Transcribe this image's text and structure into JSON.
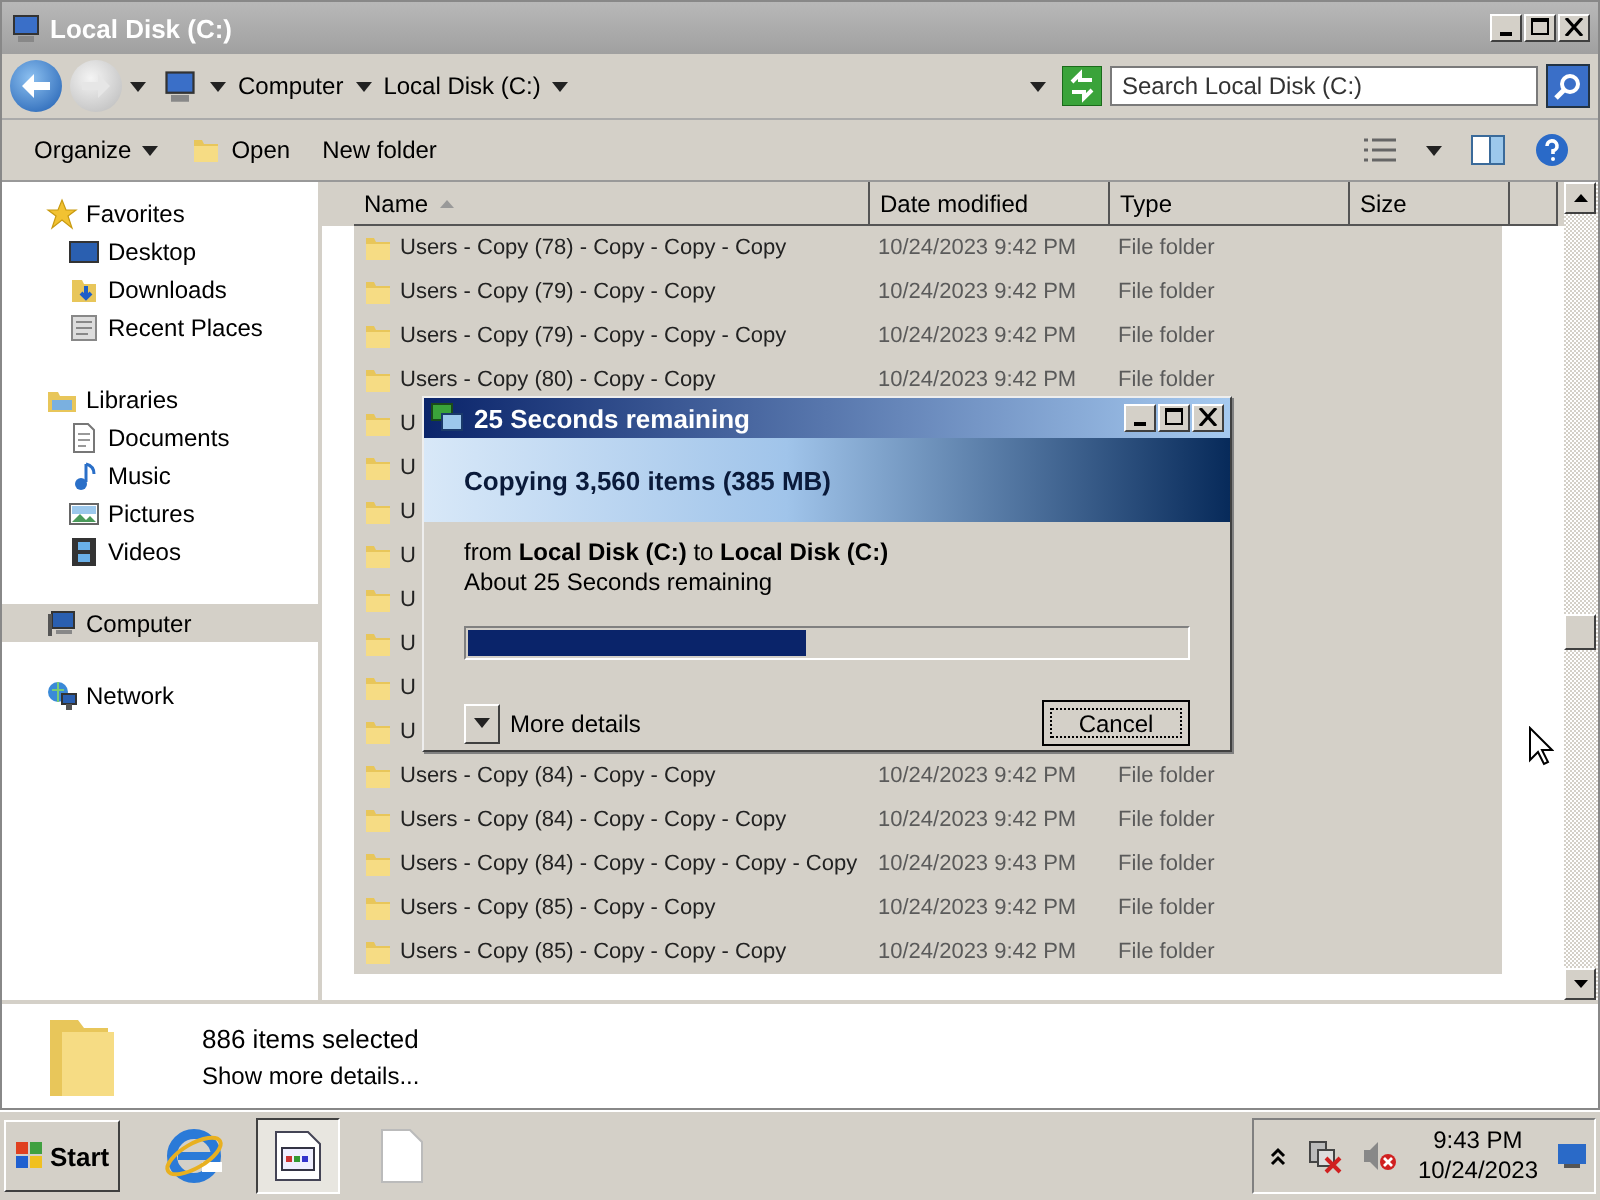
{
  "window": {
    "title": "Local Disk (C:)"
  },
  "address": {
    "breadcrumb": [
      "Computer",
      "Local Disk (C:)"
    ],
    "search": {
      "placeholder": "Search Local Disk (C:)"
    }
  },
  "toolbar": [
    {
      "label": "Organize",
      "kind": "menu"
    },
    {
      "label": "Open",
      "kind": "open"
    },
    {
      "label": "New folder",
      "kind": "plain"
    }
  ],
  "sidebar": {
    "groups": [
      {
        "label": "Favorites",
        "kind": "star",
        "selected": false,
        "children": [
          {
            "label": "Desktop",
            "kind": "desktop",
            "selected": false
          },
          {
            "label": "Downloads",
            "kind": "downloads",
            "selected": false
          },
          {
            "label": "Recent Places",
            "kind": "recent",
            "selected": false
          }
        ]
      },
      {
        "label": "Libraries",
        "kind": "libraries",
        "selected": false,
        "children": [
          {
            "label": "Documents",
            "kind": "documents",
            "selected": false
          },
          {
            "label": "Music",
            "kind": "music",
            "selected": false
          },
          {
            "label": "Pictures",
            "kind": "pictures",
            "selected": false
          },
          {
            "label": "Videos",
            "kind": "videos",
            "selected": false
          }
        ]
      },
      {
        "label": "Computer",
        "kind": "computer",
        "selected": true
      },
      {
        "label": "Network",
        "kind": "network",
        "selected": false
      }
    ]
  },
  "table": {
    "columns": [
      {
        "label": "Name",
        "sorted": true
      },
      {
        "label": "Date modified",
        "sorted": false
      },
      {
        "label": "Type",
        "sorted": false
      },
      {
        "label": "Size",
        "sorted": false
      }
    ],
    "rows": [
      {
        "name": "Users - Copy (78) - Copy - Copy - Copy",
        "date": "10/24/2023 9:42 PM",
        "type": "File folder",
        "selected": true
      },
      {
        "name": "Users - Copy (79) - Copy - Copy",
        "date": "10/24/2023 9:42 PM",
        "type": "File folder",
        "selected": true
      },
      {
        "name": "Users - Copy (79) - Copy - Copy - Copy",
        "date": "10/24/2023 9:42 PM",
        "type": "File folder",
        "selected": true
      },
      {
        "name": "Users - Copy (80) - Copy - Copy",
        "date": "10/24/2023 9:42 PM",
        "type": "File folder",
        "selected": true
      },
      {
        "name": "U",
        "selected": true
      },
      {
        "name": "U",
        "selected": true
      },
      {
        "name": "U",
        "selected": true
      },
      {
        "name": "U",
        "selected": true
      },
      {
        "name": "U",
        "selected": true
      },
      {
        "name": "U",
        "selected": true
      },
      {
        "name": "U",
        "selected": true
      },
      {
        "name": "U",
        "selected": true
      },
      {
        "name": "Users - Copy (84) - Copy - Copy",
        "date": "10/24/2023 9:42 PM",
        "type": "File folder",
        "selected": true
      },
      {
        "name": "Users - Copy (84) - Copy - Copy - Copy",
        "date": "10/24/2023 9:42 PM",
        "type": "File folder",
        "selected": true
      },
      {
        "name": "Users - Copy (84) - Copy - Copy - Copy - Copy",
        "date": "10/24/2023 9:43 PM",
        "type": "File folder",
        "selected": true
      },
      {
        "name": "Users - Copy (85) - Copy - Copy",
        "date": "10/24/2023 9:42 PM",
        "type": "File folder",
        "selected": true
      },
      {
        "name": "Users - Copy (85) - Copy - Copy - Copy",
        "date": "10/24/2023 9:42 PM",
        "type": "File folder",
        "selected": true
      }
    ]
  },
  "dialog": {
    "title": "25 Seconds remaining",
    "heading": "Copying 3,560 items (385 MB)",
    "route": "from **Local Disk (C:)** to **Local Disk (C:)**",
    "eta": "About 25 Seconds remaining",
    "level": 0.47,
    "more_details": "More details",
    "button": "Cancel"
  },
  "details": {
    "count": "886 items selected",
    "link": "Show more details..."
  },
  "taskbar": {
    "start": "Start",
    "items": [
      {
        "kind": "browser",
        "selected": false
      },
      {
        "kind": "window",
        "selected": true
      },
      {
        "kind": "document",
        "selected": false
      }
    ],
    "time": "9:43 PM",
    "date": "10/24/2023"
  }
}
